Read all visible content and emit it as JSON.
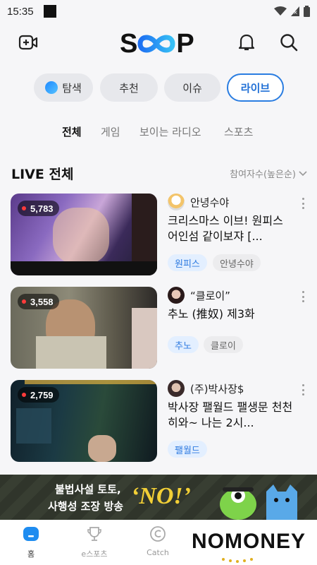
{
  "status": {
    "time": "15:35"
  },
  "app": {
    "logo": "SOOP"
  },
  "chips": [
    {
      "label": "탐색"
    },
    {
      "label": "추천"
    },
    {
      "label": "이슈"
    },
    {
      "label": "라이브"
    }
  ],
  "subtabs": [
    {
      "label": "전체"
    },
    {
      "label": "게임"
    },
    {
      "label": "보이는 라디오"
    },
    {
      "label": "스포츠"
    }
  ],
  "section": {
    "title": "LIVE 전체",
    "sort": "참여자수(높은순)"
  },
  "streams": [
    {
      "viewers": "5,783",
      "channel": "안녕수야",
      "title": "크리스마스 이브! 원피스 어인섬 같이보쟈 [...",
      "tags": [
        "원피스",
        "안녕수야"
      ]
    },
    {
      "viewers": "3,558",
      "channel": "“클로이”",
      "title": "추노 (推奴) 제3화",
      "tags": [
        "추노",
        "클로이"
      ]
    },
    {
      "viewers": "2,759",
      "channel": "(주)박사장$",
      "title": "박사장 팰월드 팰생문 천천히와~ 나는 2시...",
      "tags": [
        "팰월드"
      ]
    }
  ],
  "ad": {
    "line1": "불법사설 토토,",
    "line2": "사행성 조장 방송",
    "no": "‘NO!’"
  },
  "tabbar": [
    {
      "label": "홈"
    },
    {
      "label": "e스포츠"
    },
    {
      "label": "Catch"
    }
  ],
  "overlay": {
    "text": "NOMONEY"
  },
  "colors": {
    "accent": "#2a7de1",
    "live_dot": "#ff3b3b",
    "tag_blue_bg": "#e3efff",
    "ad_bg": "#343a2f",
    "ad_yellow": "#f2cf36"
  }
}
